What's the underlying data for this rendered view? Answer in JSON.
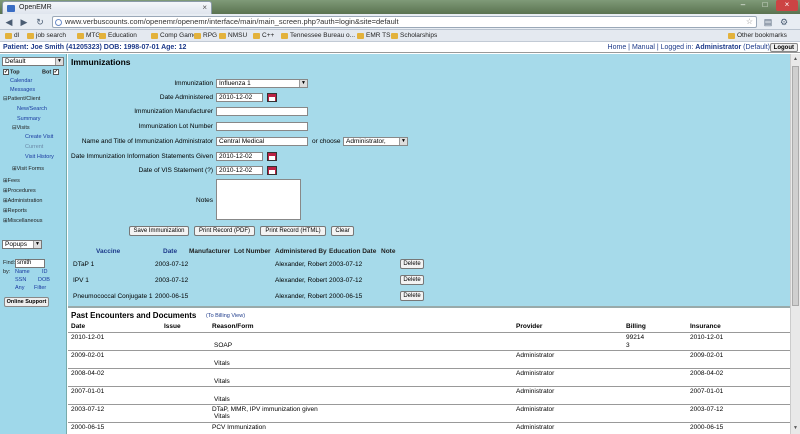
{
  "browser": {
    "tab_title": "OpenEMR",
    "url": "www.verbuscounts.com/openemr/openemr/interface/main/main_screen.php?auth=login&site=default",
    "bookmarks": [
      "dl",
      "job search",
      "MTG",
      "Education",
      "Comp Game",
      "RPG",
      "NMSU",
      "C++",
      "Tennessee Bureau o...",
      "EMR TS",
      "Scholarships"
    ],
    "other_bookmarks": "Other bookmarks"
  },
  "header": {
    "patient": "Patient: Joe Smith (41205323) DOB: 1998-07-01 Age: 12",
    "home": "Home",
    "manual": "Manual",
    "logged_in": "Logged in:",
    "user": "Administrator",
    "site": "(Default)",
    "logout": "Logout"
  },
  "leftnav": {
    "mode_select": "Default",
    "top": "Top",
    "bot": "Bot",
    "items": {
      "calendar": "Calendar",
      "messages": "Messages",
      "patient_client": "Patient/Client",
      "new_search": "New/Search",
      "summary": "Summary",
      "visits": "Visits",
      "create_visit": "Create Visit",
      "current": "Current",
      "visit_history": "Visit History",
      "visit_forms": "Visit Forms",
      "fees": "Fees",
      "procedures": "Procedures",
      "administration": "Administration",
      "reports": "Reports",
      "miscellaneous": "Miscellaneous"
    },
    "popups": "Popups",
    "find_label": "Find:",
    "find_value": "smith",
    "by_label": "by:",
    "by_name": "Name",
    "by_id": "ID",
    "by_ssn": "SSN",
    "by_dob": "DOB",
    "by_any": "Any",
    "by_filter": "Filter",
    "online_support": "Online Support"
  },
  "form": {
    "title": "Immunizations",
    "immunization_label": "Immunization",
    "immunization_value": "Influenza 1",
    "date_administered_label": "Date Administered",
    "date_administered_value": "2010-12-02",
    "manufacturer_label": "Immunization Manufacturer",
    "lot_label": "Immunization Lot Number",
    "administrator_label": "Name and Title of Immunization Administrator",
    "administrator_value": "Central Medical",
    "or_choose": "or choose",
    "administrator_choice": "Administrator,",
    "info_statement_label": "Date Immunization Information Statements Given",
    "info_statement_value": "2010-12-02",
    "vis_label": "Date of VIS Statement (?)",
    "vis_value": "2010-12-02",
    "notes_label": "Notes",
    "buttons": {
      "save": "Save Immunization",
      "print_pdf": "Print Record (PDF)",
      "print_html": "Print Record (HTML)",
      "clear": "Clear"
    }
  },
  "table": {
    "headers": [
      "Vaccine",
      "Date",
      "Manufacturer",
      "Lot Number",
      "Administered By",
      "Education Date",
      "Note"
    ],
    "rows": [
      {
        "vaccine": "DTaP 1",
        "date": "2003-07-12",
        "admin": "Alexander, Robert",
        "edu": "2003-07-12",
        "action": "Delete"
      },
      {
        "vaccine": "IPV 1",
        "date": "2003-07-12",
        "admin": "Alexander, Robert",
        "edu": "2003-07-12",
        "action": "Delete"
      },
      {
        "vaccine": "Pneumococcal Conjugate 1",
        "date": "2000-06-15",
        "admin": "Alexander, Robert",
        "edu": "2000-06-15",
        "action": "Delete"
      }
    ]
  },
  "encounters": {
    "title": "Past Encounters and Documents",
    "billing_view": "(To Billing View)",
    "headers": {
      "date": "Date",
      "issue": "Issue",
      "reason": "Reason/Form",
      "provider": "Provider",
      "billing": "Billing",
      "insurance": "Insurance"
    },
    "rows": [
      {
        "date": "2010-12-01",
        "reason": "",
        "form": "SOAP",
        "provider": "",
        "billing": "99214",
        "billing2": "3",
        "insurance": "2010-12-01"
      },
      {
        "date": "2009-02-01",
        "reason": "",
        "form": "Vitals",
        "provider": "Administrator",
        "billing": "",
        "billing2": "",
        "insurance": "2009-02-01"
      },
      {
        "date": "2008-04-02",
        "reason": "",
        "form": "Vitals",
        "provider": "Administrator",
        "billing": "",
        "billing2": "",
        "insurance": "2008-04-02"
      },
      {
        "date": "2007-01-01",
        "reason": "",
        "form": "Vitals",
        "provider": "Administrator",
        "billing": "",
        "billing2": "",
        "insurance": "2007-01-01"
      },
      {
        "date": "2003-07-12",
        "reason": "DTaP, MMR, IPV immunization given",
        "form": "Vitals",
        "provider": "Administrator",
        "billing": "",
        "billing2": "",
        "insurance": "2003-07-12"
      },
      {
        "date": "2000-06-15",
        "reason": "PCV Immunization",
        "form": "",
        "provider": "Administrator",
        "billing": "",
        "billing2": "",
        "insurance": "2000-06-15"
      }
    ]
  }
}
